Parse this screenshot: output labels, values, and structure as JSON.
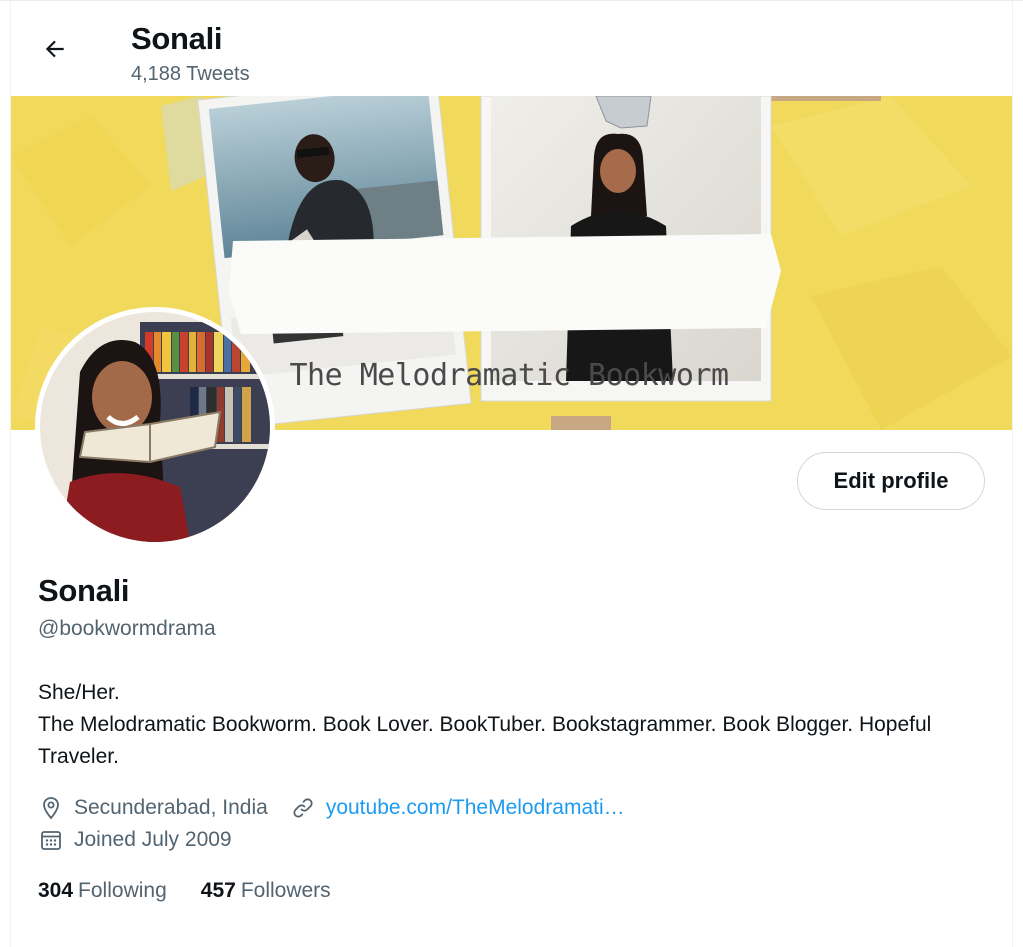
{
  "header": {
    "name": "Sonali",
    "tweet_count": "4,188 Tweets"
  },
  "banner": {
    "text": "The Melodramatic Bookworm"
  },
  "actions": {
    "edit_profile_label": "Edit profile"
  },
  "profile": {
    "display_name": "Sonali",
    "handle": "@bookwormdrama",
    "bio_line1": "She/Her.",
    "bio_line2": "The Melodramatic Bookworm. Book Lover. BookTuber. Bookstagrammer. Book Blogger. Hopeful Traveler.",
    "location": "Secunderabad, India",
    "website": "youtube.com/TheMelodramati…",
    "joined": "Joined July 2009"
  },
  "stats": {
    "following_count": "304",
    "following_label": "Following",
    "followers_count": "457",
    "followers_label": "Followers"
  },
  "icons": {
    "back": "arrow-left-icon",
    "location": "location-pin-icon",
    "link": "link-icon",
    "calendar": "calendar-icon"
  },
  "colors": {
    "accent": "#1d9bf0",
    "secondary_text": "#536471",
    "banner_yellow": "#f1d95c"
  }
}
